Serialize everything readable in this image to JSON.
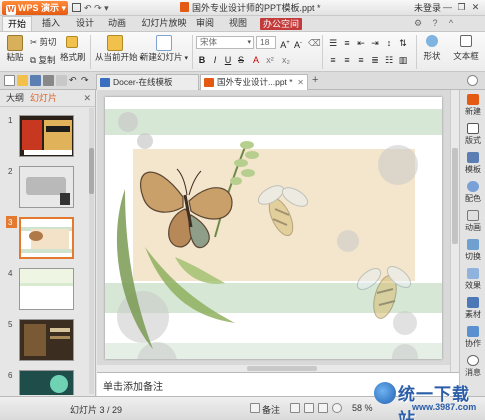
{
  "titlebar": {
    "app_button": "WPS 演示",
    "doc_title": "国外专业设计师的PPT模板.ppt *",
    "login": "未登录",
    "min": "—",
    "restore": "❐",
    "close": "✕"
  },
  "menu": {
    "tabs": [
      "开始",
      "插入",
      "设计",
      "动画",
      "幻灯片放映",
      "审阅",
      "视图"
    ],
    "office": "办公空间",
    "active_index": 0
  },
  "ribbon": {
    "paste": "粘贴",
    "cut": "剪切",
    "copy": "复制",
    "format_painter": "格式刷",
    "start_from_current": "从当前开始",
    "new_slide": "新建幻灯片",
    "font_name": "宋体",
    "font_size": "18",
    "bold": "B",
    "italic": "I",
    "underline": "U",
    "strike": "S",
    "font_color": "A",
    "shape": "形状",
    "textbox": "文本框"
  },
  "doc_tabs": [
    {
      "label": "Docer-在线模板",
      "active": false
    },
    {
      "label": "国外专业设计...ppt *",
      "active": true
    }
  ],
  "left_panel": {
    "tab_outline": "大纲",
    "tab_slides": "幻灯片",
    "close": "✕",
    "slides": [
      {
        "number": "1",
        "active": false
      },
      {
        "number": "2",
        "active": false
      },
      {
        "number": "3",
        "active": true
      },
      {
        "number": "4",
        "active": false
      },
      {
        "number": "5",
        "active": false
      },
      {
        "number": "6",
        "active": false
      }
    ]
  },
  "notes": {
    "placeholder": "单击添加备注"
  },
  "right_bar": {
    "items": [
      "新建",
      "版式",
      "模板",
      "配色",
      "动画",
      "切换",
      "效果",
      "素材",
      "协作",
      "消息"
    ]
  },
  "status": {
    "slide_counter": "幻灯片 3 / 29",
    "notes_label": "备注",
    "zoom": "58 %"
  },
  "watermark": {
    "text": "统一下载站",
    "url": "www.3987.com"
  },
  "colors": {
    "accent_orange": "#e37a30",
    "office_red": "#c23a3a",
    "slide_green": "#cfe3cf",
    "slide_peach": "#f3e2c8"
  }
}
